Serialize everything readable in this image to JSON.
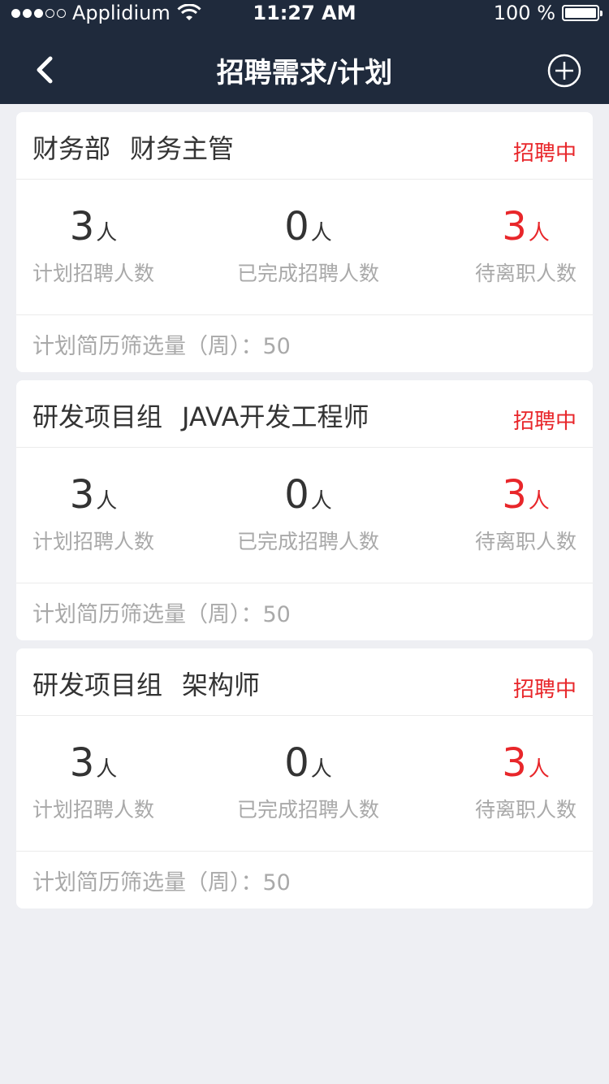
{
  "status_bar": {
    "carrier": "Applidium",
    "time": "11:27 AM",
    "battery": "100 %",
    "battery_level": 1.0
  },
  "nav": {
    "title": "招聘需求/计划",
    "back_icon": "chevron-left-icon",
    "add_icon": "plus-circle-icon"
  },
  "colors": {
    "nav_bg": "#1F2A3C",
    "accent_red": "#E8262A",
    "page_bg": "#EEEFF3"
  },
  "cards": [
    {
      "department": "财务部",
      "position": "财务主管",
      "status": "招聘中",
      "stats": [
        {
          "value": "3",
          "unit": "人",
          "label": "计划招聘人数"
        },
        {
          "value": "0",
          "unit": "人",
          "label": "已完成招聘人数"
        },
        {
          "value": "3",
          "unit": "人",
          "label": "待离职人数"
        }
      ],
      "footer": "计划简历筛选量（周）：50"
    },
    {
      "department": "研发项目组",
      "position": "JAVA开发工程师",
      "status": "招聘中",
      "stats": [
        {
          "value": "3",
          "unit": "人",
          "label": "计划招聘人数"
        },
        {
          "value": "0",
          "unit": "人",
          "label": "已完成招聘人数"
        },
        {
          "value": "3",
          "unit": "人",
          "label": "待离职人数"
        }
      ],
      "footer": "计划简历筛选量（周）：50"
    },
    {
      "department": "研发项目组",
      "position": "架构师",
      "status": "招聘中",
      "stats": [
        {
          "value": "3",
          "unit": "人",
          "label": "计划招聘人数"
        },
        {
          "value": "0",
          "unit": "人",
          "label": "已完成招聘人数"
        },
        {
          "value": "3",
          "unit": "人",
          "label": "待离职人数"
        }
      ],
      "footer": "计划简历筛选量（周）：50"
    }
  ]
}
